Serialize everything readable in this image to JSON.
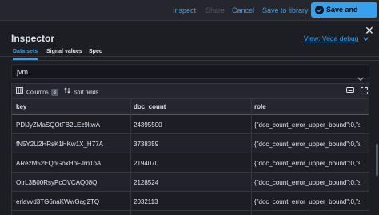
{
  "toolbar": {
    "inspect": "Inspect",
    "share": "Share",
    "cancel": "Cancel",
    "save_to_library": "Save to library",
    "save_and_return": "Save and return"
  },
  "flyout": {
    "title": "Inspector",
    "view_link": "View: Vega debug",
    "tabs": [
      "Data sets",
      "Signal values",
      "Spec"
    ],
    "active_tab": "Data sets",
    "dataset_select": "jvm"
  },
  "grid_toolbar": {
    "columns_label": "Columns",
    "columns_count": "3",
    "sort_label": "Sort fields"
  },
  "table": {
    "headers": [
      "key",
      "doc_count",
      "role"
    ],
    "rows": [
      [
        "PDlJyZMaSQOtFB2LEz9kwA",
        "24395500",
        "{\"doc_count_error_upper_bound\":0,\"s"
      ],
      [
        "fN5Y2U2HRsK1HKw1X_H77A",
        "3738359",
        "{\"doc_count_error_upper_bound\":0,\"s"
      ],
      [
        "ARezM52EQhGoxHoFJrn1oA",
        "2194070",
        "{\"doc_count_error_upper_bound\":0,\"s"
      ],
      [
        "OtrL3B00RsyPcOVCAQ08Q",
        "2128524",
        "{\"doc_count_error_upper_bound\":0,\"s"
      ],
      [
        "erlavvd3TG6naKWwGag2TQ",
        "2032113",
        "{\"doc_count_error_upper_bound\":0,\"s"
      ]
    ]
  },
  "colors": {
    "accent": "#36a2ef",
    "background": "#1d1e24",
    "text": "#dfe5ef"
  },
  "icons": [
    "check-circle-icon",
    "close-icon",
    "chevron-down-icon",
    "columns-icon",
    "sort-icon",
    "keyboard-icon",
    "fullscreen-icon"
  ]
}
